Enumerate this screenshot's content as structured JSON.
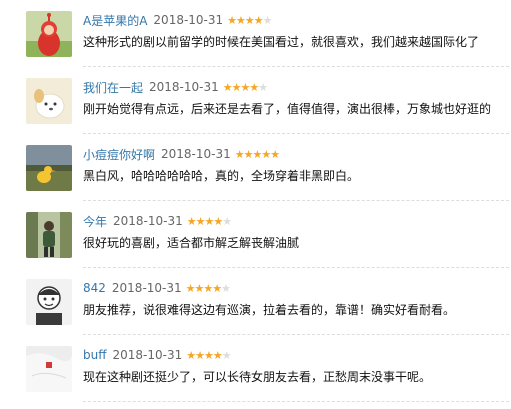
{
  "reviews": [
    {
      "user": "A是苹果的A",
      "date": "2018-10-31",
      "rating": 4,
      "max_rating": 5,
      "comment": "这种形式的剧以前留学的时候在美国看过，就很喜欢，我们越来越国际化了",
      "avatar_icon": "teletubby-avatar-icon"
    },
    {
      "user": "我们在一起",
      "date": "2018-10-31",
      "rating": 4,
      "max_rating": 5,
      "comment": "刚开始觉得有点远，后来还是去看了，值得值得，演出很棒，万象城也好逛的",
      "avatar_icon": "cartoon-dog-avatar-icon"
    },
    {
      "user": "小痘痘你好啊",
      "date": "2018-10-31",
      "rating": 5,
      "max_rating": 5,
      "comment": "黑白风，哈哈哈哈哈哈，真的，全场穿着非黑即白。",
      "avatar_icon": "duck-field-avatar-icon"
    },
    {
      "user": "今年",
      "date": "2018-10-31",
      "rating": 4,
      "max_rating": 5,
      "comment": "很好玩的喜剧，适合都市解乏解丧解油腻",
      "avatar_icon": "outdoor-person-avatar-icon"
    },
    {
      "user": "842",
      "date": "2018-10-31",
      "rating": 4,
      "max_rating": 5,
      "comment": "朋友推荐，说很难得这边有巡演，拉着去看的，靠谱！确实好看耐看。",
      "avatar_icon": "cartoon-face-avatar-icon"
    },
    {
      "user": "buff",
      "date": "2018-10-31",
      "rating": 4,
      "max_rating": 5,
      "comment": "现在这种剧还挺少了，可以长待女朋友去看，正愁周末没事干呢。",
      "avatar_icon": "white-fabric-avatar-icon"
    }
  ],
  "colors": {
    "username": "#3377aa",
    "star_filled": "#f5a623",
    "star_empty": "#dddddd",
    "text": "#111111",
    "date": "#666666"
  }
}
